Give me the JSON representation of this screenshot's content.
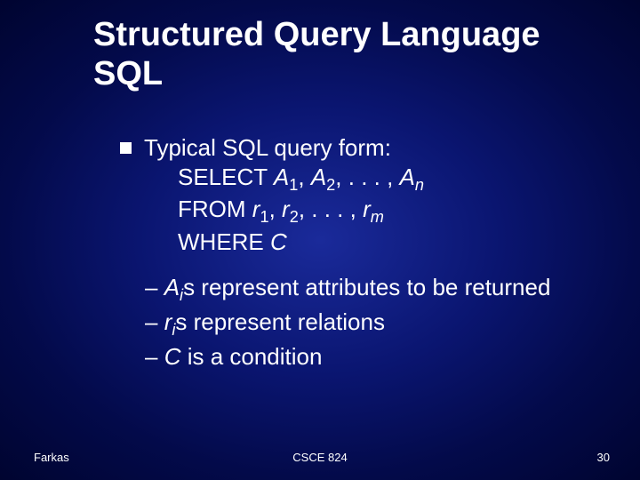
{
  "title_line1": "Structured Query Language",
  "title_line2": "SQL",
  "bullet": {
    "lead": "Typical SQL query form:",
    "select_kw": "SELECT ",
    "select_a": "A",
    "select_sep": ", ",
    "select_dots": ". . . , ",
    "from_kw": "FROM ",
    "from_r": "r",
    "where_kw": "WHERE ",
    "where_c": "C",
    "sub1": "1",
    "sub2": "2",
    "subn": "n",
    "subm": "m"
  },
  "dashes": {
    "d1_pre": "– ",
    "d1_var": "A",
    "d1_sub": "i",
    "d1_post": "s represent attributes to be returned",
    "d2_pre": "– ",
    "d2_var": "r",
    "d2_sub": "i",
    "d2_post": "s represent relations",
    "d3_pre": "– ",
    "d3_var": "C",
    "d3_post": " is a condition"
  },
  "footer": {
    "left": "Farkas",
    "center": "CSCE 824",
    "right": "30"
  }
}
